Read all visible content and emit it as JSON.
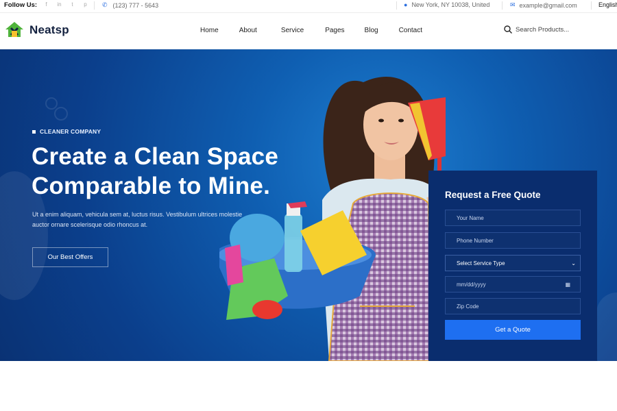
{
  "topbar": {
    "follow_label": "Follow Us:",
    "social_icons": [
      "facebook-icon",
      "linkedin-icon",
      "twitter-icon",
      "pinterest-icon"
    ],
    "phone": "(123) 777 - 5643",
    "location": "New York, NY 10038, United",
    "email": "example@gmail.com",
    "language": "English"
  },
  "header": {
    "logo_text": "Neatsp",
    "nav": [
      "Home",
      "About",
      "Service",
      "Pages",
      "Blog",
      "Contact"
    ],
    "search_placeholder": "Search Products..."
  },
  "hero": {
    "eyebrow": "CLEANER COMPANY",
    "title_line1": "Create a Clean Space",
    "title_line2": "Comparable to Mine.",
    "description": "Ut a enim aliquam, vehicula sem at, luctus risus. Vestibulum ultrices molestie auctor ornare scelerisque odio rhoncus at.",
    "cta_label": "Our Best Offers"
  },
  "quote_form": {
    "title": "Request a Free Quote",
    "name_placeholder": "Your Name",
    "phone_placeholder": "Phone Number",
    "service_select_value": "Select Service Type",
    "date_placeholder": "mm/dd/yyyy",
    "zip_placeholder": "Zip Code",
    "submit_label": "Get a Quote"
  },
  "colors": {
    "accent": "#1e6ff1",
    "hero_dark": "#0a3274",
    "panel": "#0a2d6e"
  }
}
